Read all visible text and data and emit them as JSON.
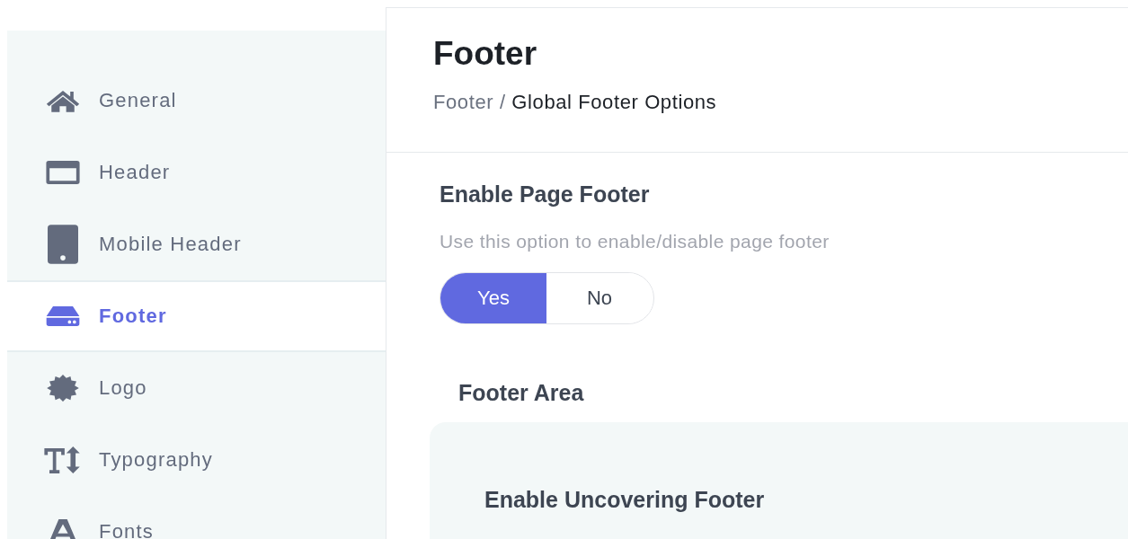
{
  "sidebar": {
    "items": [
      {
        "label": "General",
        "kind": "home",
        "selected": false
      },
      {
        "label": "Header",
        "kind": "header",
        "selected": false
      },
      {
        "label": "Mobile Header",
        "kind": "mobile",
        "selected": false
      },
      {
        "label": "Footer",
        "kind": "footer",
        "selected": true
      },
      {
        "label": "Logo",
        "kind": "logo",
        "selected": false
      },
      {
        "label": "Typography",
        "kind": "typography",
        "selected": false
      },
      {
        "label": "Fonts",
        "kind": "fonts",
        "selected": false
      }
    ]
  },
  "page": {
    "title": "Footer",
    "breadcrumb": {
      "parent": "Footer",
      "separator": "/",
      "current": "Global Footer Options"
    }
  },
  "settings": {
    "title": "Enable Page Footer",
    "description": "Use this option to enable/disable page footer",
    "options": [
      {
        "label": "Yes",
        "selected": true
      },
      {
        "label": "No",
        "selected": false
      }
    ]
  },
  "footer_area": {
    "title": "Footer Area",
    "panel": {
      "title": "Enable Uncovering Footer"
    }
  }
}
